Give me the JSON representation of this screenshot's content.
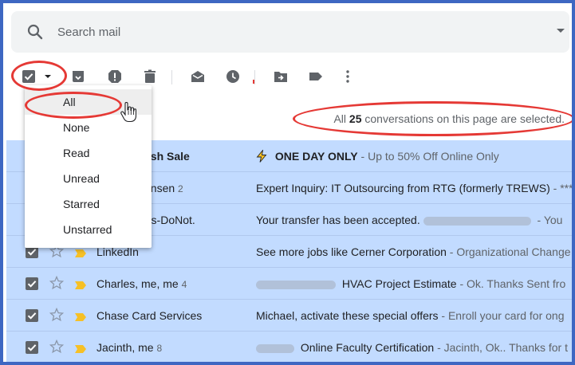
{
  "search": {
    "placeholder": "Search mail",
    "icon": "search-icon"
  },
  "toolbar": {
    "buttons": [
      {
        "name": "archive",
        "icon": "archive-icon"
      },
      {
        "name": "report-spam",
        "icon": "report-spam-icon"
      },
      {
        "name": "delete",
        "icon": "trash-icon"
      },
      {
        "name": "mark-as-read",
        "icon": "open-envelope-icon"
      },
      {
        "name": "snooze",
        "icon": "clock-icon"
      },
      {
        "name": "move-to",
        "icon": "move-to-icon"
      },
      {
        "name": "labels",
        "icon": "label-icon"
      },
      {
        "name": "more",
        "icon": "more-vert-icon"
      }
    ]
  },
  "select_menu": {
    "items": [
      "All",
      "None",
      "Read",
      "Unread",
      "Starred",
      "Unstarred"
    ],
    "highlighted": "All"
  },
  "banner": {
    "prefix": "All",
    "count": "25",
    "suffix": "conversations on this page are selected."
  },
  "emails": [
    {
      "sender": "ash Sale",
      "count": "",
      "sender_bold": true,
      "has_emoji": true,
      "subject": "ONE DAY ONLY",
      "subject_bold": true,
      "snippet": " - Up to 50% Off Online Only"
    },
    {
      "sender": "ansen",
      "count": "2",
      "subject": "Expert Inquiry: IT Outsourcing from RTG (formerly TREWS)",
      "snippet": " - ***"
    },
    {
      "sender": "rts-DoNot.",
      "count": "",
      "subject": "Your transfer has been accepted.",
      "snippet": " - You"
    },
    {
      "sender": "LinkedIn",
      "count": "",
      "subject": "See more jobs like Cerner Corporation",
      "snippet": " - Organizational Change"
    },
    {
      "sender": "Charles, me, me",
      "count": "4",
      "subject": "HVAC Project Estimate",
      "snippet": " - Ok. Thanks Sent fro"
    },
    {
      "sender": "Chase Card Services",
      "count": "",
      "subject": "Michael, activate these special offers",
      "snippet": " - Enroll your card for ong"
    },
    {
      "sender": "Jacinth, me",
      "count": "8",
      "subject": "Online Faculty Certification",
      "snippet": " - Jacinth, Ok.. Thanks for t"
    }
  ],
  "colors": {
    "selected_row": "#c2dbff",
    "annotation": "#e53935",
    "important_marker": "#f6c026",
    "frame": "#3e67c2"
  }
}
